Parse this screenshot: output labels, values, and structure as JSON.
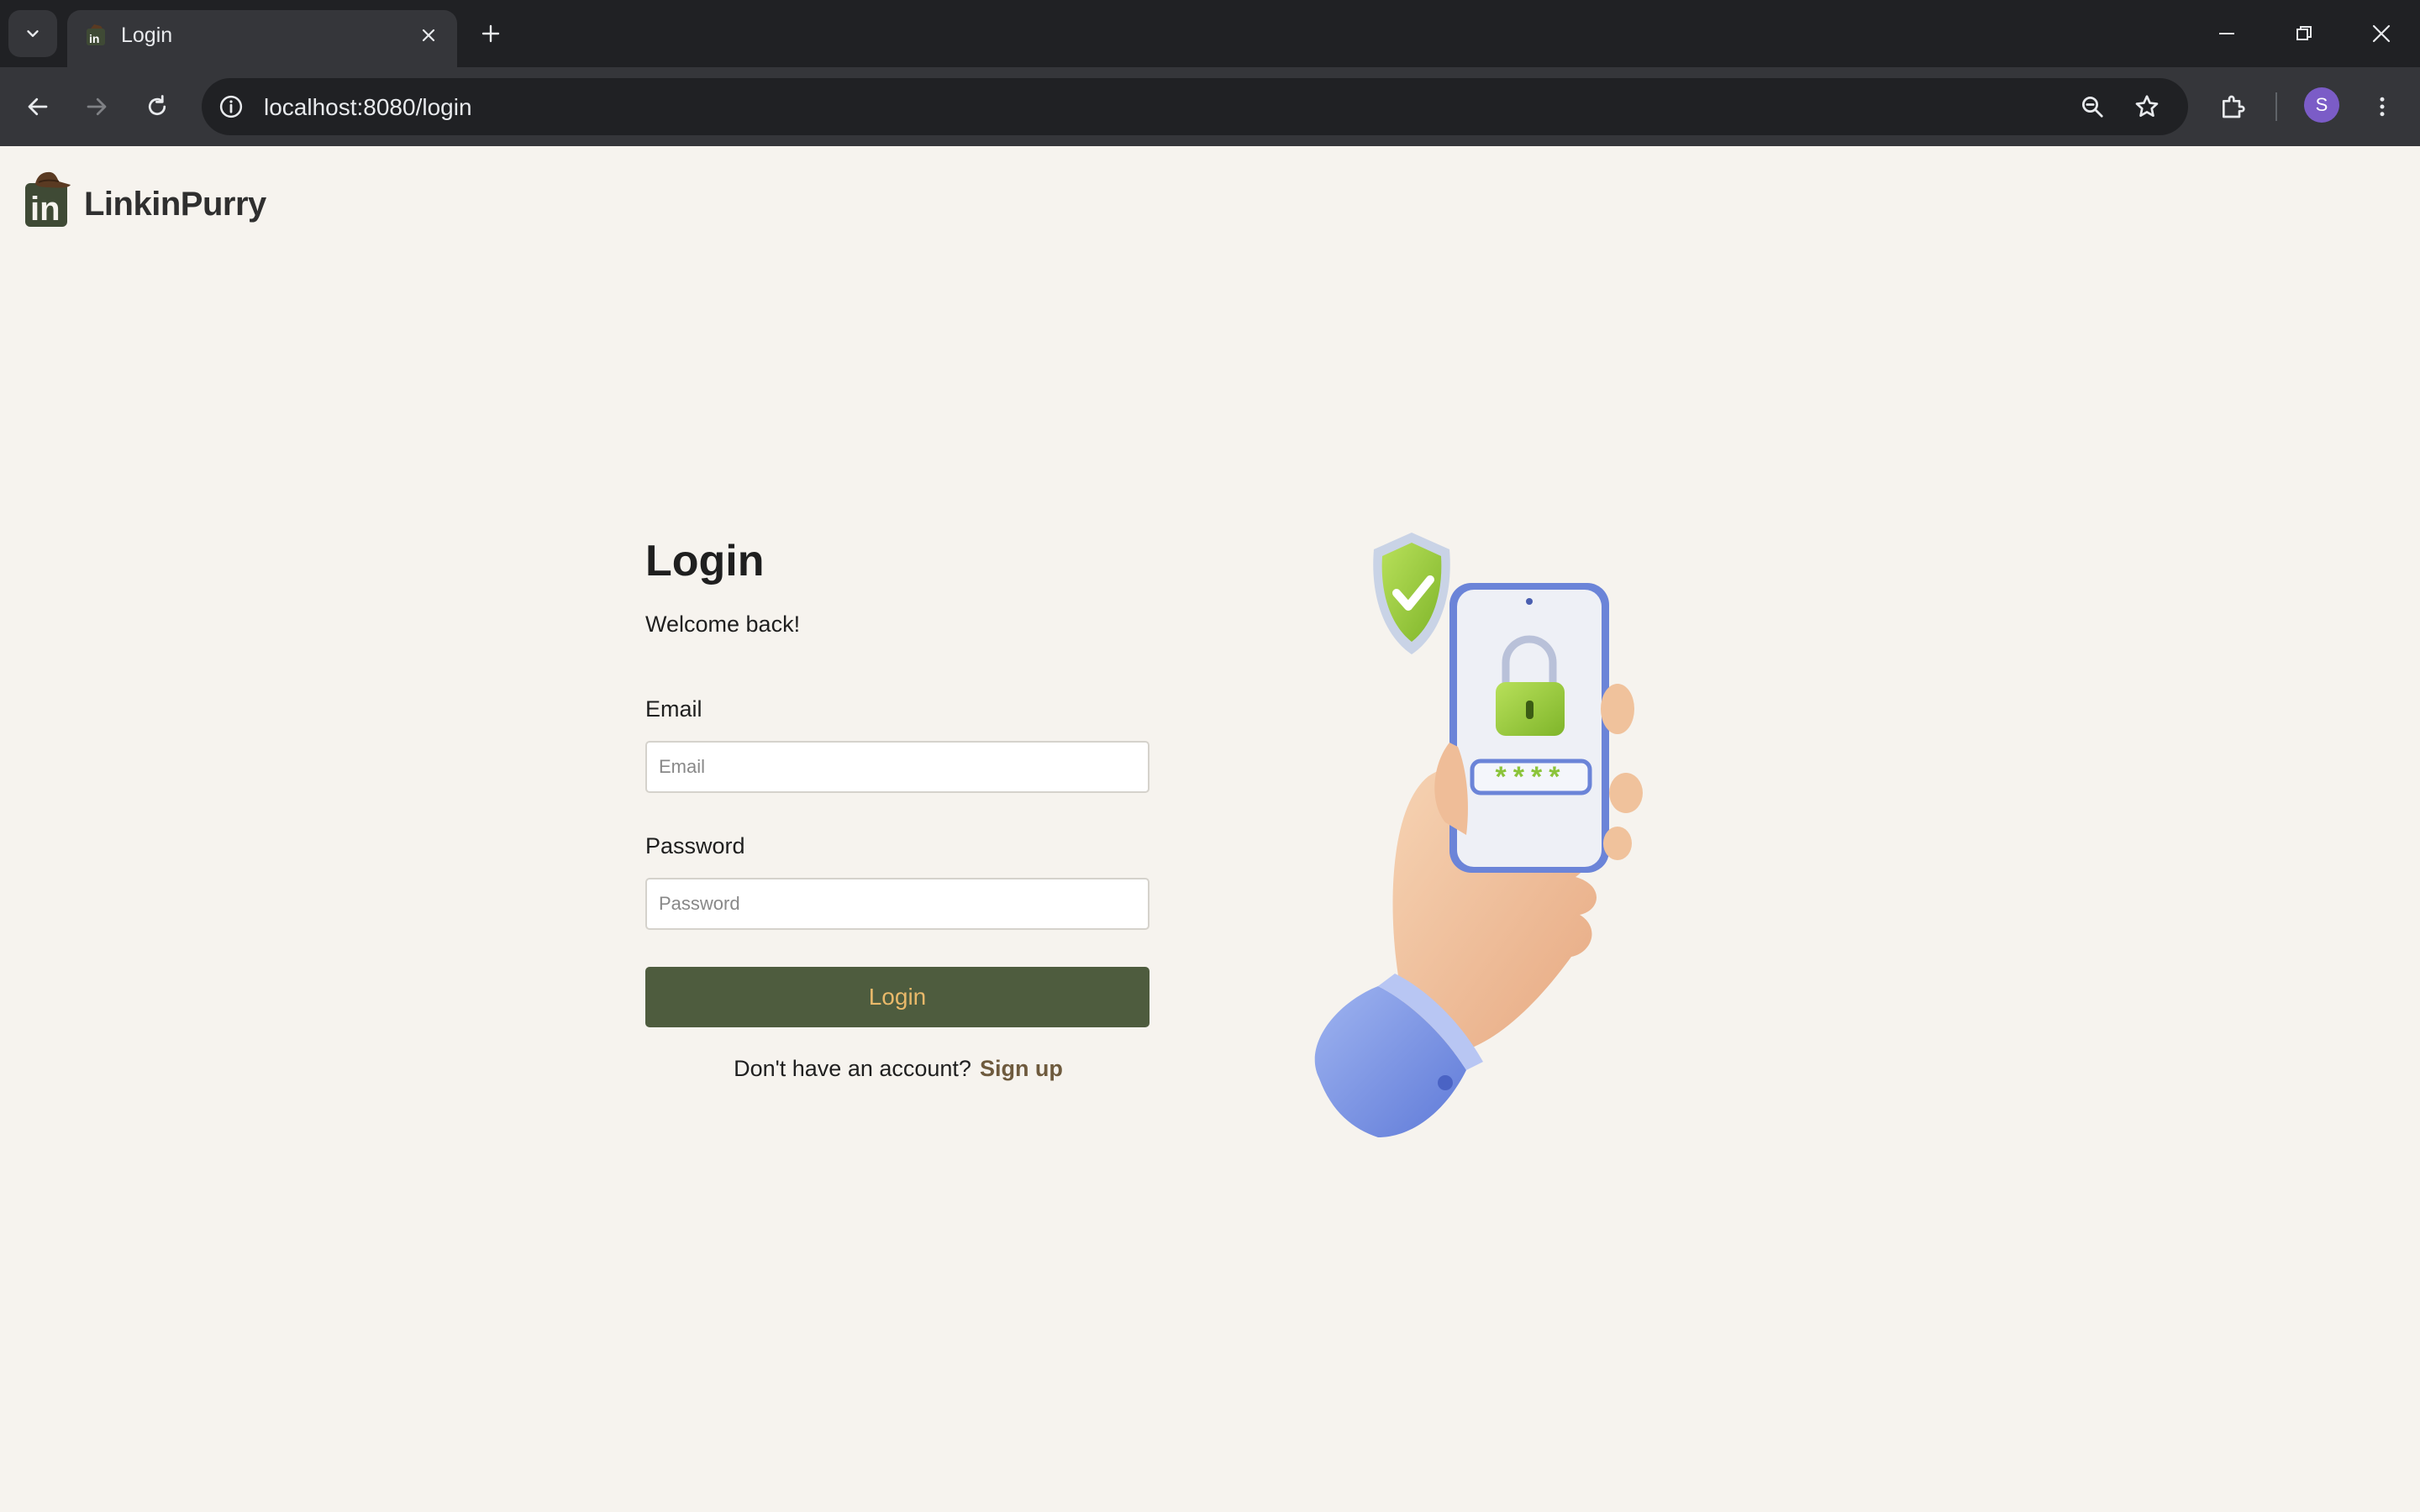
{
  "browser": {
    "tab": {
      "title": "Login"
    },
    "url": "localhost:8080/login",
    "profile_initial": "S"
  },
  "brand": {
    "name": "LinkinPurry"
  },
  "login": {
    "title": "Login",
    "subtitle": "Welcome back!",
    "email_label": "Email",
    "email_placeholder": "Email",
    "email_value": "",
    "password_label": "Password",
    "password_placeholder": "Password",
    "password_value": "",
    "submit_label": "Login",
    "signup_prompt": "Don't have an account?",
    "signup_link": "Sign up"
  },
  "illustration": {
    "pin_mask": "****"
  },
  "colors": {
    "page_background": "#f6f3ee",
    "button_background": "#4e5c3e",
    "button_text": "#e9b96a",
    "link": "#6e5a3d",
    "brand_green": "#3f4a35"
  },
  "icons": [
    "tab-search-icon",
    "favicon-icon",
    "close-icon",
    "plus-icon",
    "minimize-icon",
    "restore-icon",
    "window-close-icon",
    "back-icon",
    "forward-icon",
    "reload-icon",
    "site-info-icon",
    "zoom-icon",
    "bookmark-star-icon",
    "extensions-icon",
    "kebab-menu-icon"
  ]
}
